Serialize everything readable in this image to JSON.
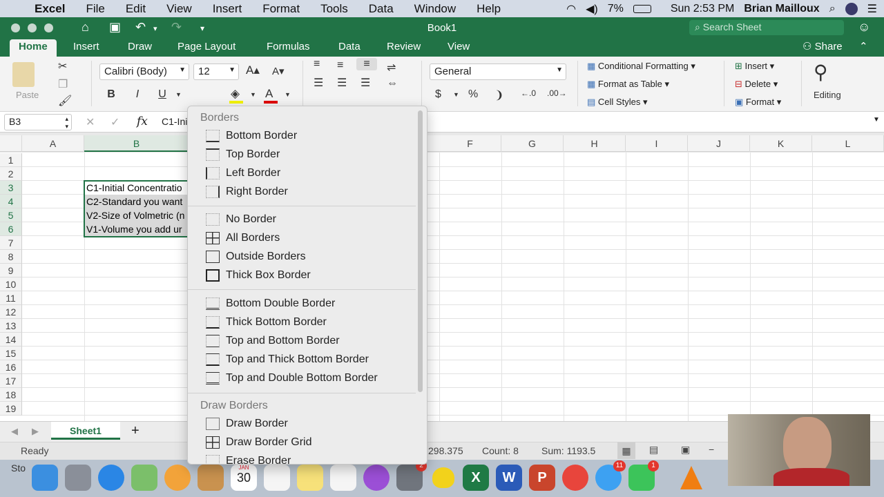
{
  "menubar": {
    "app": "Excel",
    "items": [
      "File",
      "Edit",
      "View",
      "Insert",
      "Format",
      "Tools",
      "Data",
      "Window",
      "Help"
    ],
    "battery": "7%",
    "clock": "Sun 2:53 PM",
    "user": "Brian Mailloux"
  },
  "window": {
    "title": "Book1",
    "search_placeholder": "Search Sheet"
  },
  "tabs": {
    "items": [
      "Home",
      "Insert",
      "Draw",
      "Page Layout",
      "Formulas",
      "Data",
      "Review",
      "View"
    ],
    "active": "Home",
    "share": "Share"
  },
  "ribbon": {
    "paste": "Paste",
    "font_name": "Calibri (Body)",
    "font_size": "12",
    "bold": "B",
    "italic": "I",
    "underline": "U",
    "number_format": "General",
    "currency": "$",
    "percent": "%",
    "comma": "❩",
    "cond_format": "Conditional Formatting",
    "format_table": "Format as Table",
    "cell_styles": "Cell Styles",
    "insert": "Insert",
    "delete": "Delete",
    "format": "Format",
    "editing": "Editing"
  },
  "formula_bar": {
    "name_box": "B3",
    "fx": "fx",
    "content": "C1-Ini"
  },
  "grid": {
    "columns": [
      "A",
      "B",
      "F",
      "G",
      "H",
      "I",
      "J",
      "K",
      "L"
    ],
    "rows": [
      "1",
      "2",
      "3",
      "4",
      "5",
      "6",
      "7",
      "8",
      "9",
      "10",
      "11",
      "12",
      "13",
      "14",
      "15",
      "16",
      "17",
      "18",
      "19"
    ],
    "cells": {
      "B3": "C1-Initial Concentratio",
      "B4": "C2-Standard you want",
      "B5": "V2-Size of Volmetric (n",
      "B6": "V1-Volume you add ur"
    }
  },
  "sheet": {
    "tab": "Sheet1",
    "add": "+"
  },
  "status": {
    "ready": "Ready",
    "average": "298.375",
    "count": "Count: 8",
    "sum": "Sum: 1193.5",
    "dock_partial": "Sto"
  },
  "borders_menu": {
    "header": "Borders",
    "group1": [
      "Bottom Border",
      "Top Border",
      "Left Border",
      "Right Border"
    ],
    "group2": [
      "No Border",
      "All Borders",
      "Outside Borders",
      "Thick Box Border"
    ],
    "group3": [
      "Bottom Double Border",
      "Thick Bottom Border",
      "Top and Bottom Border",
      "Top and Thick Bottom Border",
      "Top and Double Bottom Border"
    ],
    "draw_header": "Draw Borders",
    "draw_items": [
      "Draw Border",
      "Draw Border Grid",
      "Erase Border"
    ]
  },
  "dock": {
    "calendar_month": "JAN",
    "calendar_day": "30",
    "badge_sysprefs": "2",
    "badge_messages": "11",
    "badge_facetime": "1"
  },
  "colors": {
    "excel_green": "#217346",
    "ribbon_bg": "#f3f3f3",
    "selection": "#d9d9d9"
  }
}
